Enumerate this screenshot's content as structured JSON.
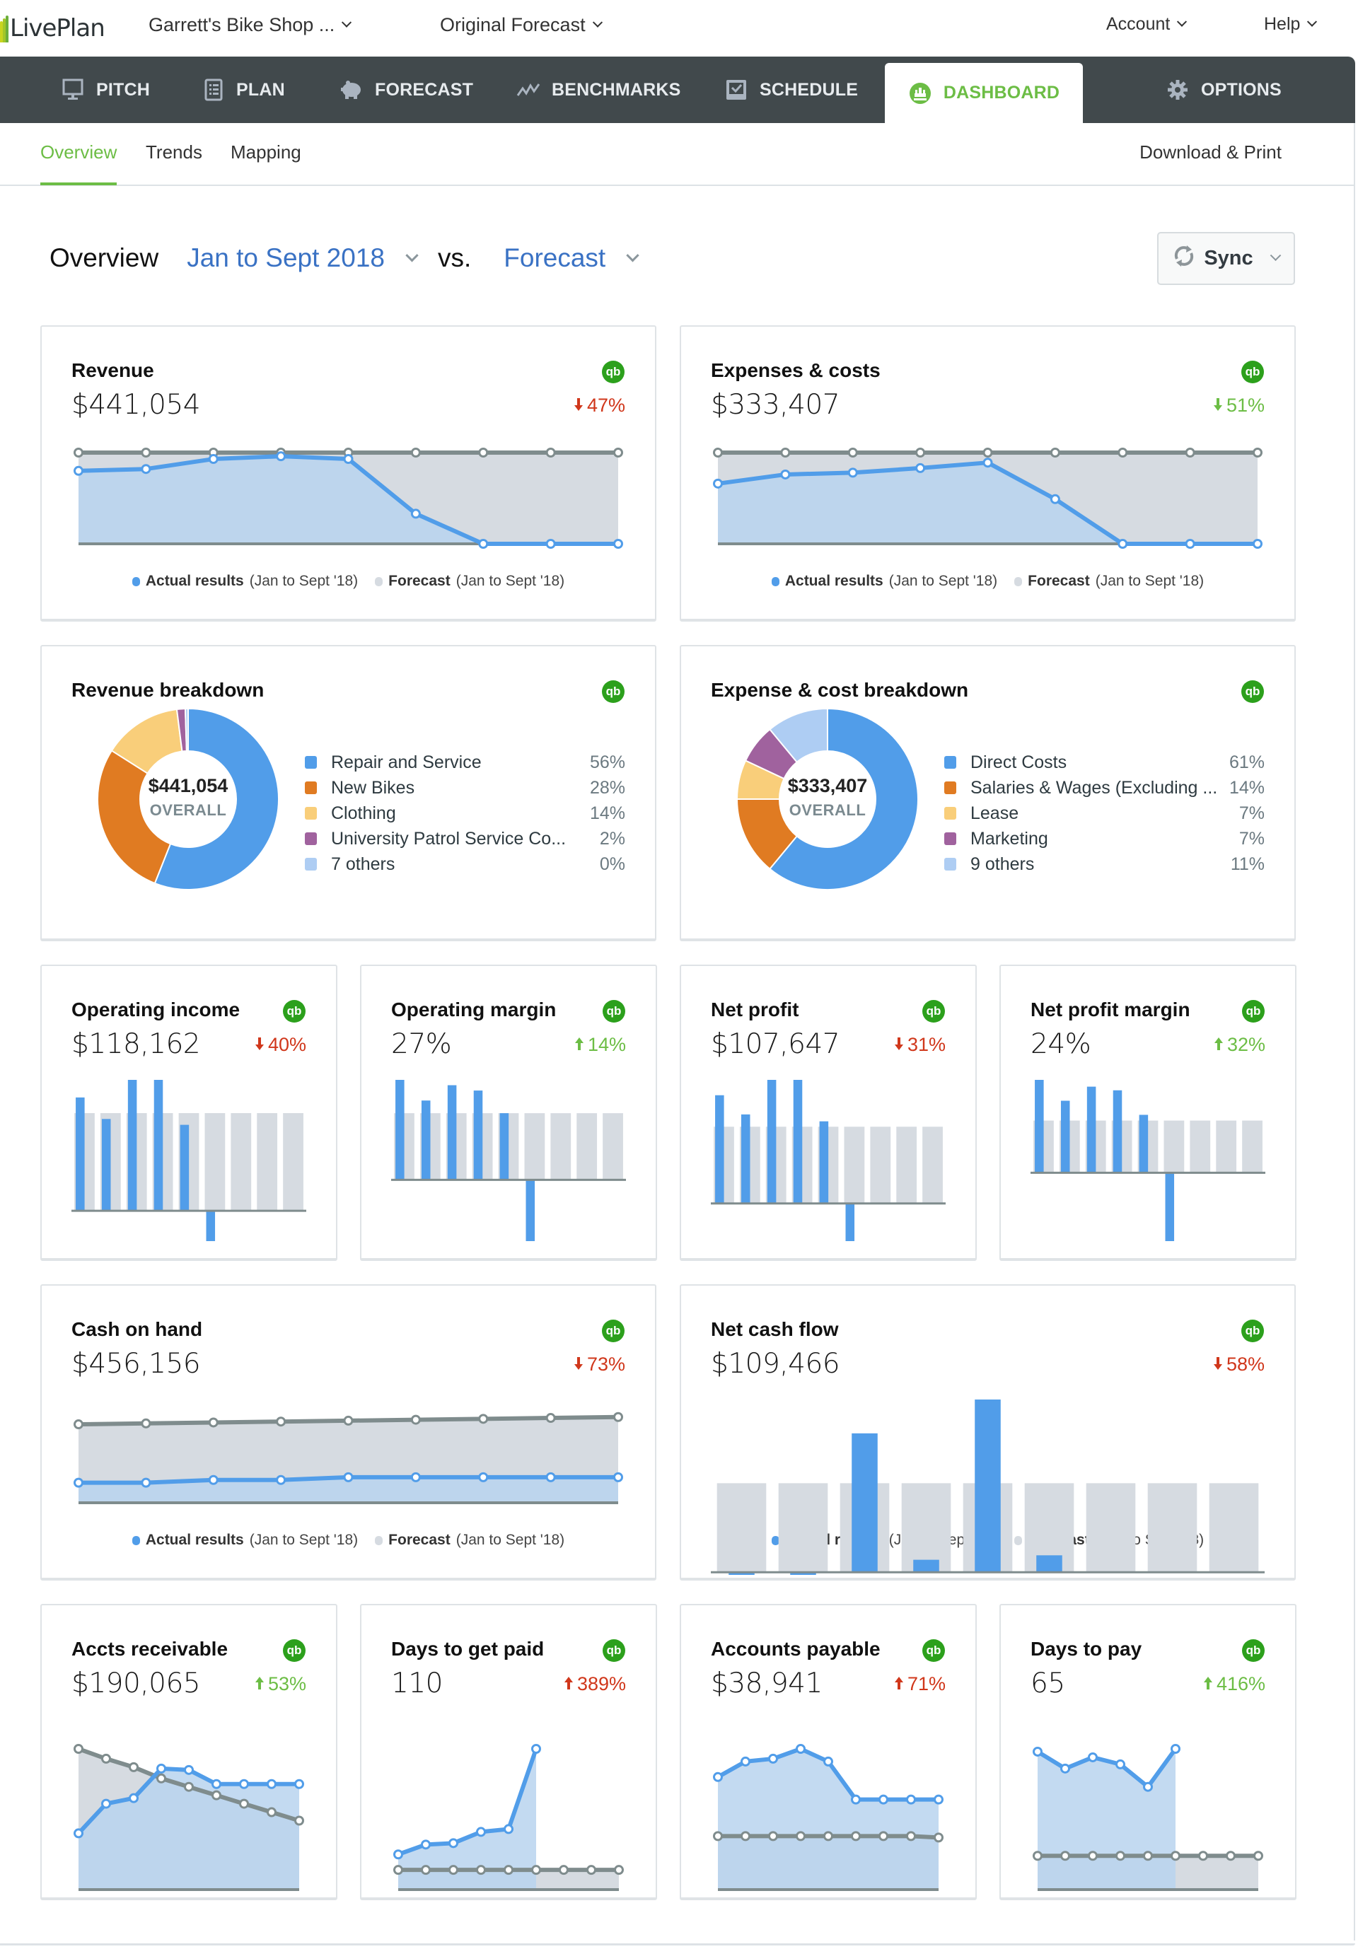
{
  "app": {
    "logo_text": "LivePlan",
    "company": "Garrett's Bike Shop ...",
    "plan": "Original Forecast",
    "account": "Account",
    "help": "Help"
  },
  "nav": [
    {
      "label": "PITCH",
      "icon": "monitor-icon"
    },
    {
      "label": "PLAN",
      "icon": "notebook-icon"
    },
    {
      "label": "FORECAST",
      "icon": "piggy-bank-icon"
    },
    {
      "label": "BENCHMARKS",
      "icon": "trend-line-icon"
    },
    {
      "label": "SCHEDULE",
      "icon": "checkbox-icon"
    },
    {
      "label": "DASHBOARD",
      "icon": "dashboard-gauge-icon",
      "active": true
    },
    {
      "label": "OPTIONS",
      "icon": "gear-icon"
    }
  ],
  "subnav": {
    "tabs": [
      "Overview",
      "Trends",
      "Mapping"
    ],
    "active": "Overview",
    "download": "Download & Print"
  },
  "header": {
    "label": "Overview",
    "period": "Jan to Sept 2018",
    "vs": "vs.",
    "compare": "Forecast",
    "sync": "Sync"
  },
  "colors": {
    "actual": "#519de9",
    "actual_fill": "#b9d3ef",
    "forecast_line": "#7f8c8d",
    "forecast_fill": "#d6dbe1",
    "down_bad": "#d0371b",
    "good": "#6cbd45",
    "quickbooks": "#2ca01c"
  },
  "legend": {
    "actual": "Actual results",
    "forecast": "Forecast",
    "range": "(Jan to Sept '18)"
  },
  "cards": {
    "revenue": {
      "title": "Revenue",
      "value": "$441,054",
      "change": "47%",
      "direction": "down",
      "tone": "bad"
    },
    "expenses": {
      "title": "Expenses & costs",
      "value": "$333,407",
      "change": "51%",
      "direction": "down",
      "tone": "good"
    },
    "revenue_breakdown": {
      "title": "Revenue breakdown",
      "total": "$441,054",
      "total_label": "OVERALL",
      "items": [
        {
          "label": "Repair and Service",
          "pct": "56%",
          "value": 56,
          "color": "#519de9"
        },
        {
          "label": "New Bikes",
          "pct": "28%",
          "value": 28,
          "color": "#e07b22"
        },
        {
          "label": "Clothing",
          "pct": "14%",
          "value": 14,
          "color": "#f9ce7a"
        },
        {
          "label": "University Patrol Service Co...",
          "pct": "2%",
          "value": 1.5,
          "color": "#a0629e"
        },
        {
          "label": "7 others",
          "pct": "0%",
          "value": 0,
          "color": "#aecdf3"
        }
      ]
    },
    "expense_breakdown": {
      "title": "Expense & cost breakdown",
      "total": "$333,407",
      "total_label": "OVERALL",
      "items": [
        {
          "label": "Direct Costs",
          "pct": "61%",
          "value": 61,
          "color": "#519de9"
        },
        {
          "label": "Salaries & Wages (Excluding ...",
          "pct": "14%",
          "value": 14,
          "color": "#e07b22"
        },
        {
          "label": "Lease",
          "pct": "7%",
          "value": 7,
          "color": "#f9ce7a"
        },
        {
          "label": "Marketing",
          "pct": "7%",
          "value": 7,
          "color": "#a0629e"
        },
        {
          "label": "9 others",
          "pct": "11%",
          "value": 11,
          "color": "#aecdf3"
        }
      ]
    },
    "operating_income": {
      "title": "Operating income",
      "value": "$118,162",
      "change": "40%",
      "direction": "down",
      "tone": "bad"
    },
    "operating_margin": {
      "title": "Operating margin",
      "value": "27%",
      "change": "14%",
      "direction": "up",
      "tone": "good"
    },
    "net_profit": {
      "title": "Net profit",
      "value": "$107,647",
      "change": "31%",
      "direction": "down",
      "tone": "bad"
    },
    "net_profit_margin": {
      "title": "Net profit margin",
      "value": "24%",
      "change": "32%",
      "direction": "up",
      "tone": "good"
    },
    "cash_on_hand": {
      "title": "Cash on hand",
      "value": "$456,156",
      "change": "73%",
      "direction": "down",
      "tone": "bad"
    },
    "net_cash_flow": {
      "title": "Net cash flow",
      "value": "$109,466",
      "change": "58%",
      "direction": "down",
      "tone": "bad"
    },
    "accts_receivable": {
      "title": "Accts receivable",
      "value": "$190,065",
      "change": "53%",
      "direction": "up",
      "tone": "good"
    },
    "days_to_get_paid": {
      "title": "Days to get paid",
      "value": "110",
      "change": "389%",
      "direction": "up",
      "tone": "bad"
    },
    "accounts_payable": {
      "title": "Accounts payable",
      "value": "$38,941",
      "change": "71%",
      "direction": "up",
      "tone": "bad"
    },
    "days_to_pay": {
      "title": "Days to pay",
      "value": "65",
      "change": "416%",
      "direction": "up",
      "tone": "good"
    }
  },
  "chart_data": [
    {
      "id": "revenue",
      "type": "area",
      "months": 9,
      "ylim": [
        0,
        100
      ],
      "series": [
        {
          "name": "Forecast",
          "values": [
            100,
            100,
            100,
            100,
            100,
            100,
            100,
            100,
            100
          ]
        },
        {
          "name": "Actual results",
          "values": [
            80,
            82,
            93,
            96,
            93,
            33,
            0,
            0,
            0
          ]
        }
      ]
    },
    {
      "id": "expenses",
      "type": "area",
      "months": 9,
      "ylim": [
        0,
        100
      ],
      "series": [
        {
          "name": "Forecast",
          "values": [
            100,
            100,
            100,
            100,
            100,
            100,
            100,
            100,
            100
          ]
        },
        {
          "name": "Actual results",
          "values": [
            66,
            76,
            78,
            83,
            89,
            49,
            0,
            0,
            0
          ]
        }
      ]
    },
    {
      "id": "revenue_breakdown",
      "type": "pie",
      "values": [
        56,
        28,
        14,
        1.5,
        0.5
      ]
    },
    {
      "id": "expense_breakdown",
      "type": "pie",
      "values": [
        61,
        14,
        7,
        7,
        11
      ]
    },
    {
      "id": "operating_income",
      "type": "bar",
      "ylim": [
        -30,
        120
      ],
      "series": [
        {
          "name": "Forecast",
          "values": [
            100,
            100,
            100,
            100,
            100,
            100,
            100,
            100,
            100
          ]
        },
        {
          "name": "Actual results",
          "values": [
            116,
            94,
            134,
            134,
            88,
            -31,
            0,
            0,
            0
          ]
        }
      ]
    },
    {
      "id": "operating_margin",
      "type": "bar",
      "ylim": [
        -70,
        100
      ],
      "series": [
        {
          "name": "Forecast",
          "values": [
            100,
            100,
            100,
            100,
            100,
            100,
            100,
            100,
            100
          ]
        },
        {
          "name": "Actual results",
          "values": [
            150,
            119,
            142,
            134,
            100,
            -92,
            0,
            0,
            0
          ]
        }
      ]
    },
    {
      "id": "net_profit",
      "type": "bar",
      "ylim": [
        -30,
        120
      ],
      "series": [
        {
          "name": "Forecast",
          "values": [
            100,
            100,
            100,
            100,
            100,
            100,
            100,
            100,
            100
          ]
        },
        {
          "name": "Actual results",
          "values": [
            141,
            116,
            161,
            161,
            107,
            -49,
            0,
            0,
            0
          ]
        }
      ]
    },
    {
      "id": "net_profit_margin",
      "type": "bar",
      "ylim": [
        -70,
        100
      ],
      "series": [
        {
          "name": "Forecast",
          "values": [
            100,
            100,
            100,
            100,
            100,
            100,
            100,
            100,
            100
          ]
        },
        {
          "name": "Actual results",
          "values": [
            178,
            138,
            165,
            158,
            111,
            -131,
            0,
            0,
            0
          ]
        }
      ]
    },
    {
      "id": "cash_on_hand",
      "type": "area",
      "months": 9,
      "ylim": [
        0,
        100
      ],
      "series": [
        {
          "name": "Forecast",
          "values": [
            86,
            87,
            88,
            89,
            90,
            91,
            92,
            93,
            94
          ]
        },
        {
          "name": "Actual results",
          "values": [
            22,
            22,
            25,
            25,
            28,
            28,
            28,
            28,
            28
          ]
        }
      ]
    },
    {
      "id": "net_cash_flow",
      "type": "bar",
      "ylim": [
        -10,
        200
      ],
      "series": [
        {
          "name": "Forecast",
          "values": [
            100,
            100,
            100,
            100,
            100,
            100,
            100,
            100,
            100
          ]
        },
        {
          "name": "Actual results",
          "values": [
            -3,
            -3,
            156,
            14,
            194,
            19,
            0,
            0,
            0
          ]
        }
      ]
    },
    {
      "id": "accts_receivable",
      "type": "area",
      "months": 9,
      "ylim": [
        0,
        100
      ],
      "series": [
        {
          "name": "Forecast",
          "values": [
            100,
            93,
            87,
            79,
            73,
            67,
            61,
            55,
            49
          ]
        },
        {
          "name": "Actual results",
          "values": [
            40,
            61,
            65,
            86,
            85,
            75,
            75,
            75,
            75
          ]
        }
      ]
    },
    {
      "id": "days_to_get_paid",
      "type": "area",
      "months": 9,
      "ylim": [
        0,
        100
      ],
      "actual_months": 6,
      "series": [
        {
          "name": "Forecast",
          "values": [
            14,
            14,
            14,
            14,
            14,
            14,
            14,
            14,
            14
          ]
        },
        {
          "name": "Actual results",
          "values": [
            25,
            32,
            33,
            41,
            43,
            100
          ]
        }
      ]
    },
    {
      "id": "accounts_payable",
      "type": "area",
      "months": 9,
      "ylim": [
        0,
        100
      ],
      "series": [
        {
          "name": "Forecast",
          "values": [
            38,
            38,
            38,
            38,
            38,
            38,
            38,
            38,
            37
          ]
        },
        {
          "name": "Actual results",
          "values": [
            80,
            91,
            93,
            100,
            91,
            64,
            64,
            64,
            64
          ]
        }
      ]
    },
    {
      "id": "days_to_pay",
      "type": "area",
      "months": 9,
      "ylim": [
        0,
        100
      ],
      "actual_months": 6,
      "series": [
        {
          "name": "Forecast",
          "values": [
            24,
            24,
            24,
            24,
            24,
            24,
            24,
            24,
            24
          ]
        },
        {
          "name": "Actual results",
          "values": [
            98,
            86,
            94,
            89,
            73,
            100
          ]
        }
      ]
    }
  ]
}
